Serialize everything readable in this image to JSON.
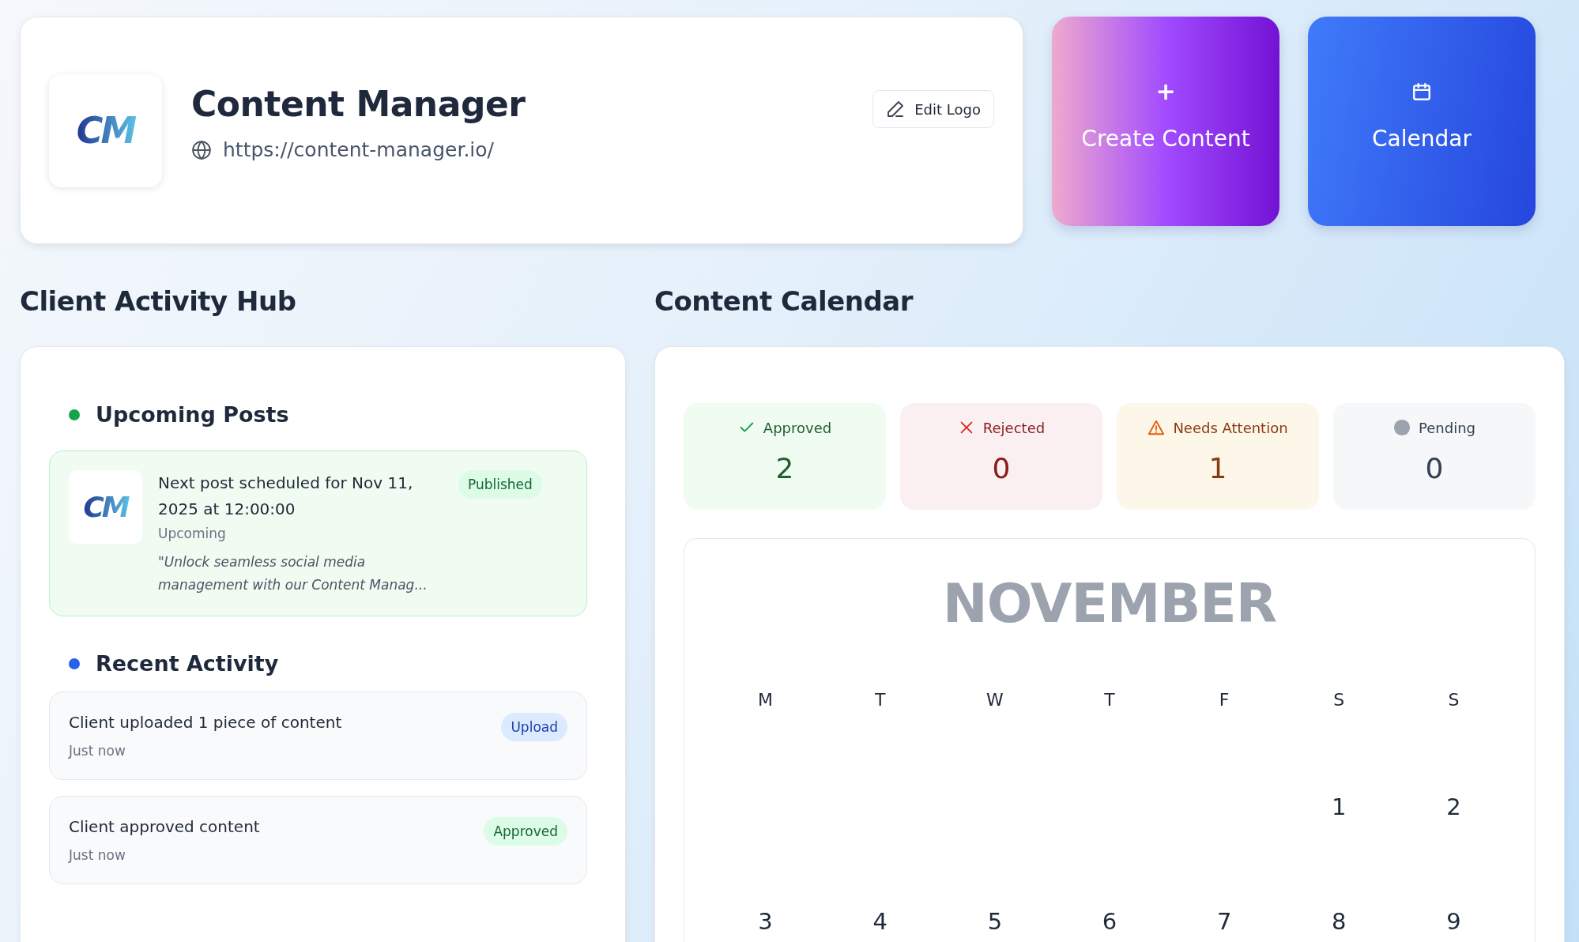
{
  "profile": {
    "logo": "CM",
    "title": "Content Manager",
    "url": "https://content-manager.io/",
    "edit_button": "Edit Logo"
  },
  "actions": [
    {
      "kind": "create",
      "label": "Create Content",
      "icon": "+"
    },
    {
      "kind": "calendar",
      "label": "Calendar"
    }
  ],
  "activity_hub": {
    "title": "Client Activity Hub",
    "upcoming": {
      "title": "Upcoming Posts",
      "color": "#16a34a",
      "post": {
        "logo": "CM",
        "text": "Next post scheduled for Nov 11, 2025 at 12:00:00",
        "status": "Upcoming",
        "excerpt": "\"Unlock seamless social media management with our Content Manag...",
        "badge": {
          "kind": "published",
          "label": "Published"
        }
      }
    },
    "recent": {
      "title": "Recent Activity",
      "color": "#2563eb",
      "items": [
        {
          "text": "Client uploaded 1 piece of content",
          "time": "Just now",
          "badge": {
            "kind": "upload",
            "label": "Upload"
          }
        },
        {
          "text": "Client approved content",
          "time": "Just now",
          "badge": {
            "kind": "approved",
            "label": "Approved"
          }
        }
      ]
    }
  },
  "content_calendar": {
    "title": "Content Calendar",
    "stats": [
      {
        "kind": "approved",
        "label": "Approved",
        "count": "2"
      },
      {
        "kind": "rejected",
        "label": "Rejected",
        "count": "0"
      },
      {
        "kind": "attention",
        "label": "Needs Attention",
        "count": "1"
      },
      {
        "kind": "pending",
        "label": "Pending",
        "count": "0"
      }
    ],
    "month": "NOVEMBER",
    "weekdays": [
      "M",
      "T",
      "W",
      "T",
      "F",
      "S",
      "S"
    ],
    "weeks": [
      {
        "kind": "first",
        "days": [
          "1",
          "2"
        ]
      },
      {
        "kind": "full",
        "days": [
          "3",
          "4",
          "5",
          "6",
          "7",
          "8",
          "9"
        ]
      }
    ]
  }
}
